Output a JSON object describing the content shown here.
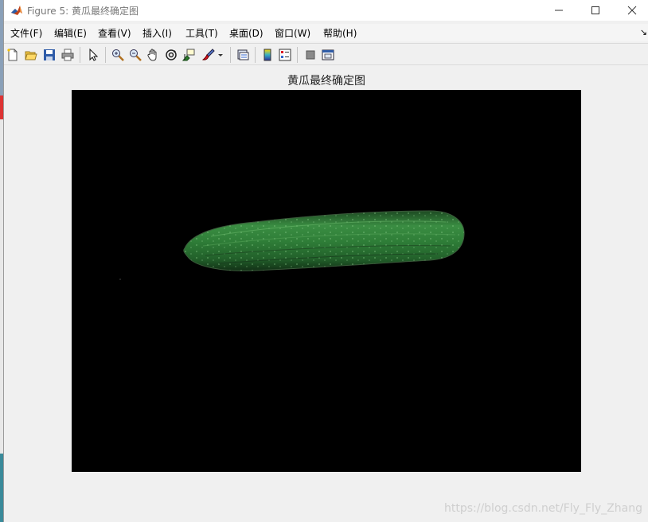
{
  "window": {
    "title": "Figure 5: 黄瓜最终确定图",
    "controls": [
      "minimize-icon",
      "maximize-icon",
      "close-icon"
    ]
  },
  "menubar": {
    "items": [
      "文件(F)",
      "编辑(E)",
      "查看(V)",
      "插入(I)",
      "工具(T)",
      "桌面(D)",
      "窗口(W)",
      "帮助(H)"
    ]
  },
  "toolbar": {
    "buttons": [
      "new-figure-icon",
      "open-file-icon",
      "save-icon",
      "print-icon",
      "edit-plot-icon",
      "zoom-in-icon",
      "zoom-out-icon",
      "pan-icon",
      "rotate-3d-icon",
      "data-cursor-icon",
      "brush-icon",
      "brush-dropdown-icon",
      "link-plot-icon",
      "colorbar-icon",
      "legend-icon",
      "hide-plot-tools-icon",
      "show-plot-tools-icon"
    ]
  },
  "figure": {
    "axes_title": "黄瓜最终确定图",
    "image_description": "cucumber",
    "background_color": "#000000"
  },
  "watermark": "https://blog.csdn.net/Fly_Fly_Zhang",
  "colors": {
    "title_text": "#777777",
    "figure_background": "#f0f0f0",
    "cucumber_green": "#2f8a3a"
  }
}
